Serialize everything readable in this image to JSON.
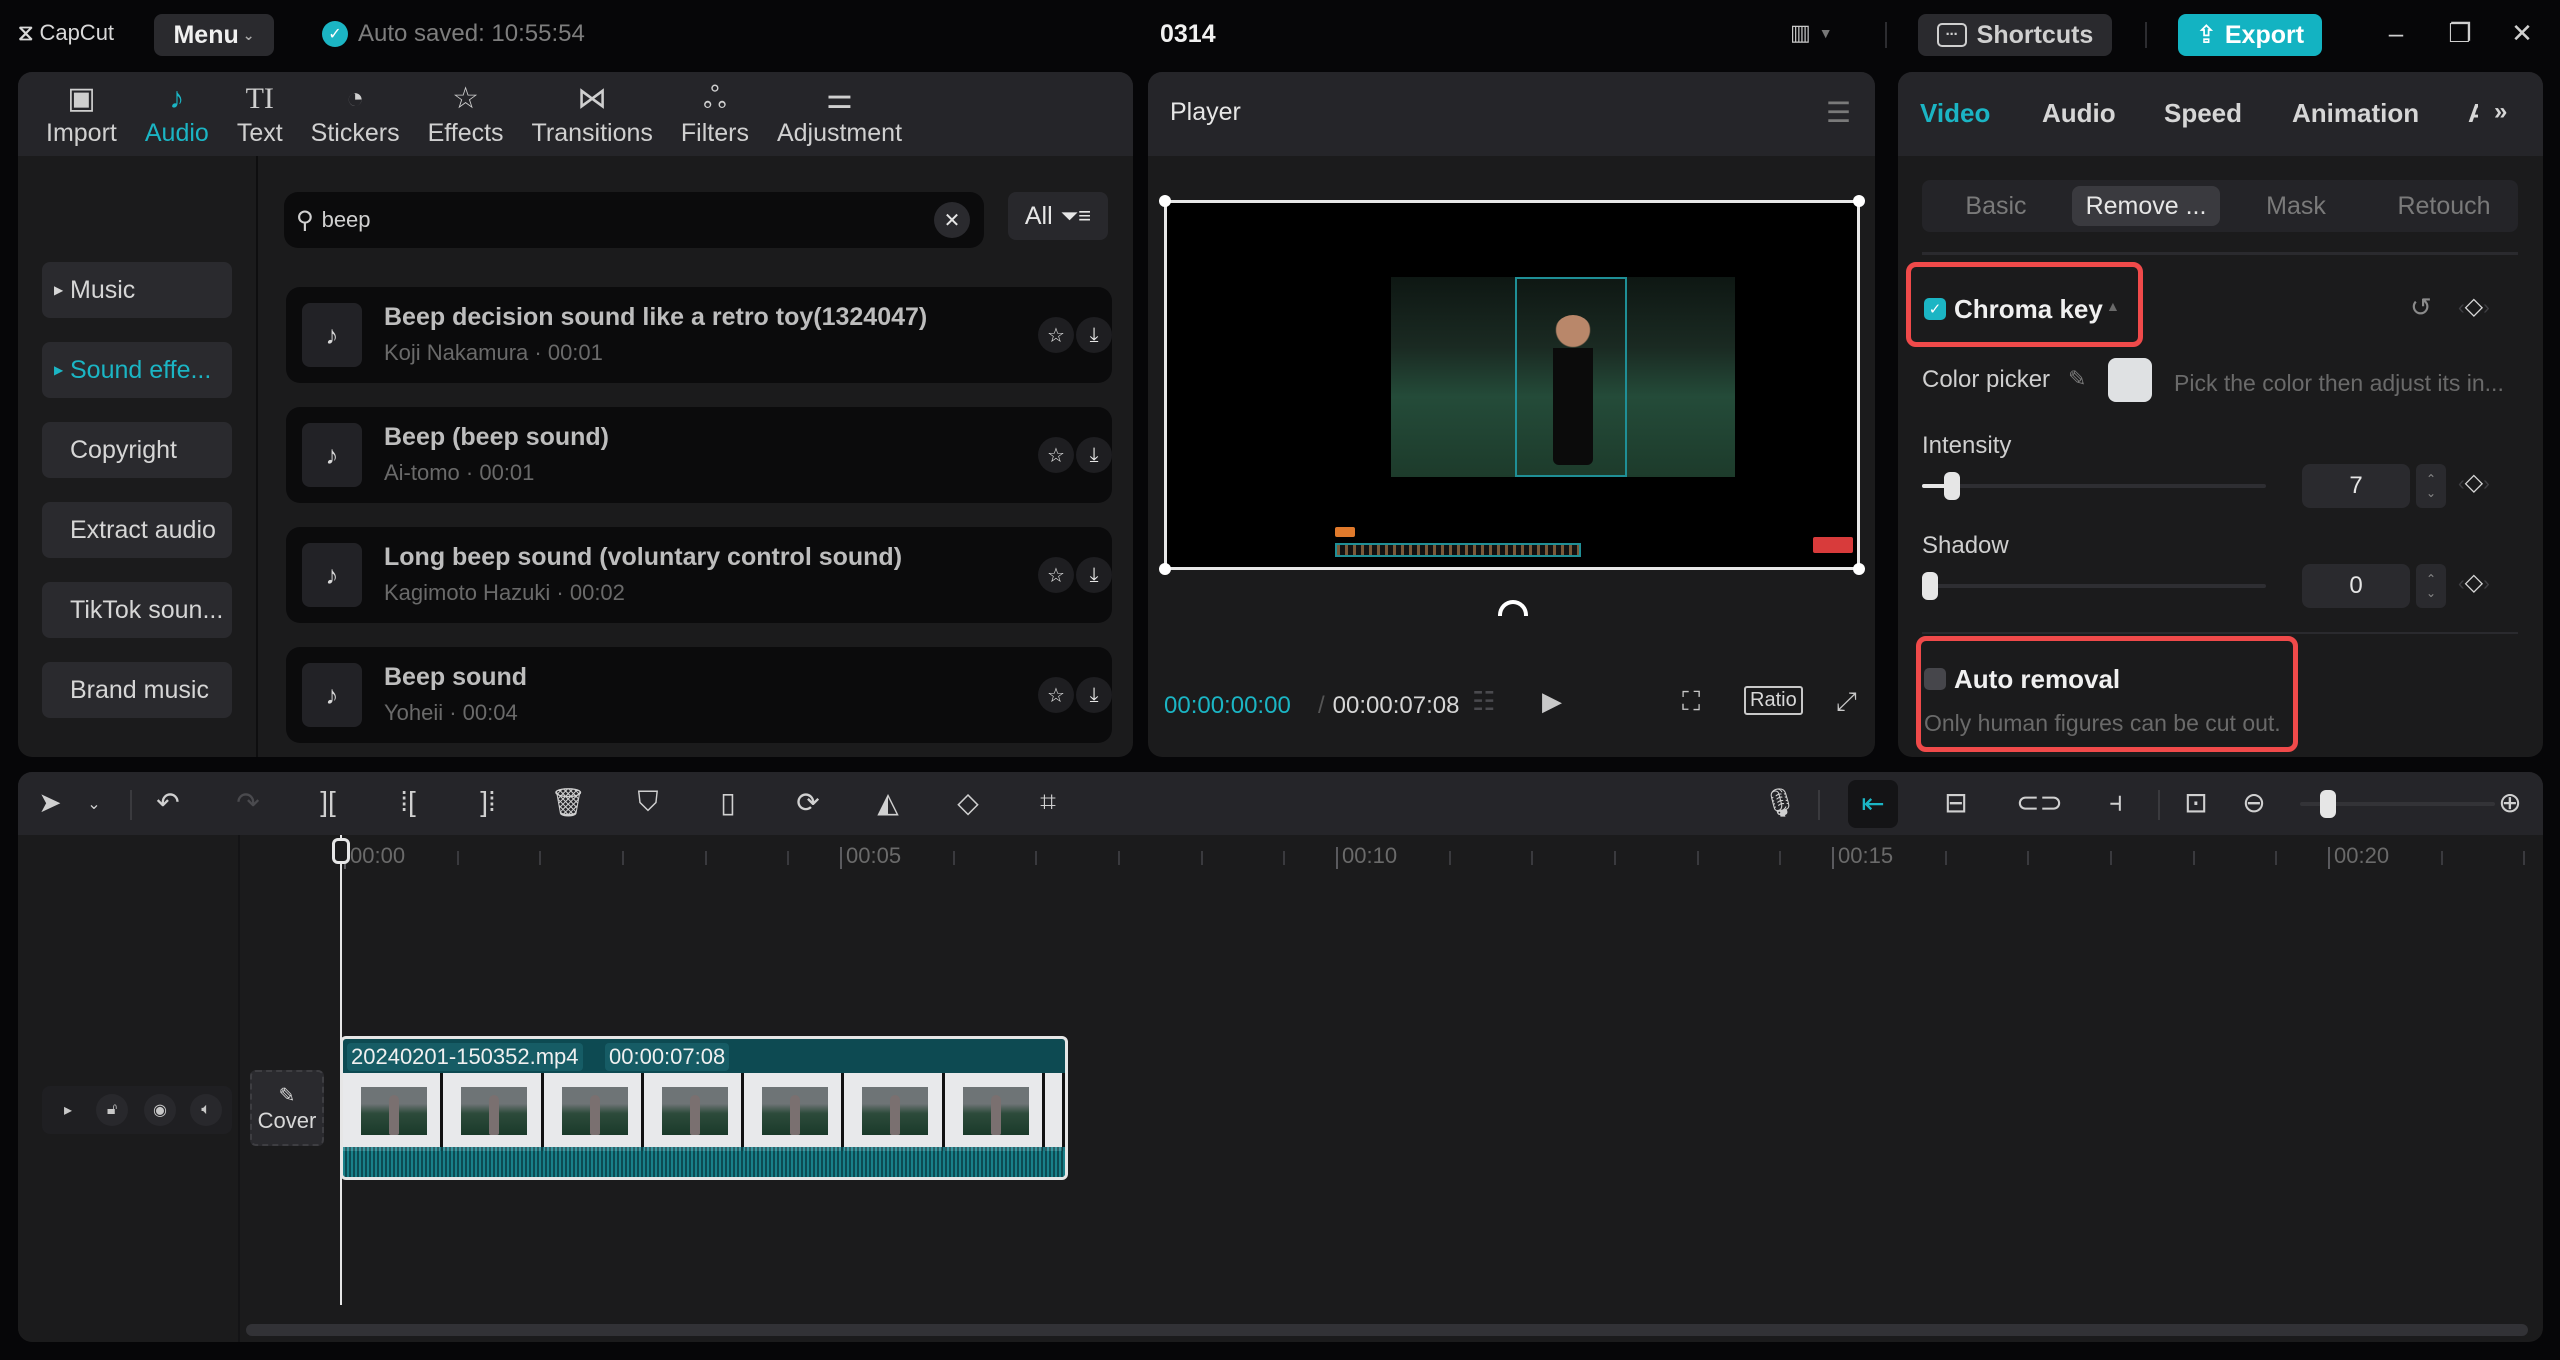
{
  "app": {
    "logo_text": "CapCut",
    "menu_label": "Menu",
    "autosave_text": "Auto saved: 10:55:54",
    "project_title": "0314",
    "shortcuts_label": "Shortcuts",
    "export_label": "Export",
    "accent_color": "#1bb5c4"
  },
  "left_panel": {
    "tabs": [
      {
        "label": "Import",
        "icon": "import-icon"
      },
      {
        "label": "Audio",
        "icon": "audio-icon",
        "active": true
      },
      {
        "label": "Text",
        "icon": "text-icon"
      },
      {
        "label": "Stickers",
        "icon": "stickers-icon"
      },
      {
        "label": "Effects",
        "icon": "effects-icon"
      },
      {
        "label": "Transitions",
        "icon": "transitions-icon"
      },
      {
        "label": "Filters",
        "icon": "filters-icon"
      },
      {
        "label": "Adjustment",
        "icon": "adjustment-icon"
      }
    ],
    "categories": [
      {
        "label": "Music",
        "expandable": true
      },
      {
        "label": "Sound effe...",
        "expandable": true,
        "active": true
      },
      {
        "label": "Copyright"
      },
      {
        "label": "Extract audio"
      },
      {
        "label": "TikTok soun..."
      },
      {
        "label": "Brand music"
      }
    ],
    "search": {
      "value": "beep",
      "placeholder": ""
    },
    "filter_label": "All",
    "results": [
      {
        "title": "Beep decision sound like a retro toy(1324047)",
        "meta": "Koji Nakamura · 00:01"
      },
      {
        "title": "Beep (beep sound)",
        "meta": "Ai-tomo · 00:01"
      },
      {
        "title": "Long beep sound (voluntary control sound)",
        "meta": "Kagimoto Hazuki · 00:02"
      },
      {
        "title": "Beep sound",
        "meta": "Yoheii · 00:04"
      }
    ]
  },
  "player": {
    "title": "Player",
    "current_time": "00:00:00:00",
    "separator": "/",
    "total_time": "00:00:07:08",
    "ratio_label": "Ratio"
  },
  "right_panel": {
    "tabs": [
      "Video",
      "Audio",
      "Speed",
      "Animation",
      "A"
    ],
    "active_tab": "Video",
    "subtabs": [
      "Basic",
      "Remove ...",
      "Mask",
      "Retouch"
    ],
    "active_subtab": "Remove ...",
    "chroma_key": {
      "label": "Chroma key",
      "checked": true,
      "color_picker_label": "Color picker",
      "picked_color": "#dfe1e3",
      "hint": "Pick the color then adjust its in...",
      "intensity_label": "Intensity",
      "intensity_value": "7",
      "intensity_fraction": 0.07,
      "shadow_label": "Shadow",
      "shadow_value": "0",
      "shadow_fraction": 0
    },
    "auto_removal": {
      "label": "Auto removal",
      "checked": false,
      "hint": "Only human figures can be cut out."
    },
    "highlight_color": "#f04a4a"
  },
  "timeline": {
    "ruler_labels": [
      "00:00",
      "00:05",
      "00:10",
      "00:15",
      "00:20"
    ],
    "cover_label": "Cover",
    "clip": {
      "name": "20240201-150352.mp4",
      "duration": "00:00:07:08"
    },
    "zoom_fraction": 0.1
  }
}
